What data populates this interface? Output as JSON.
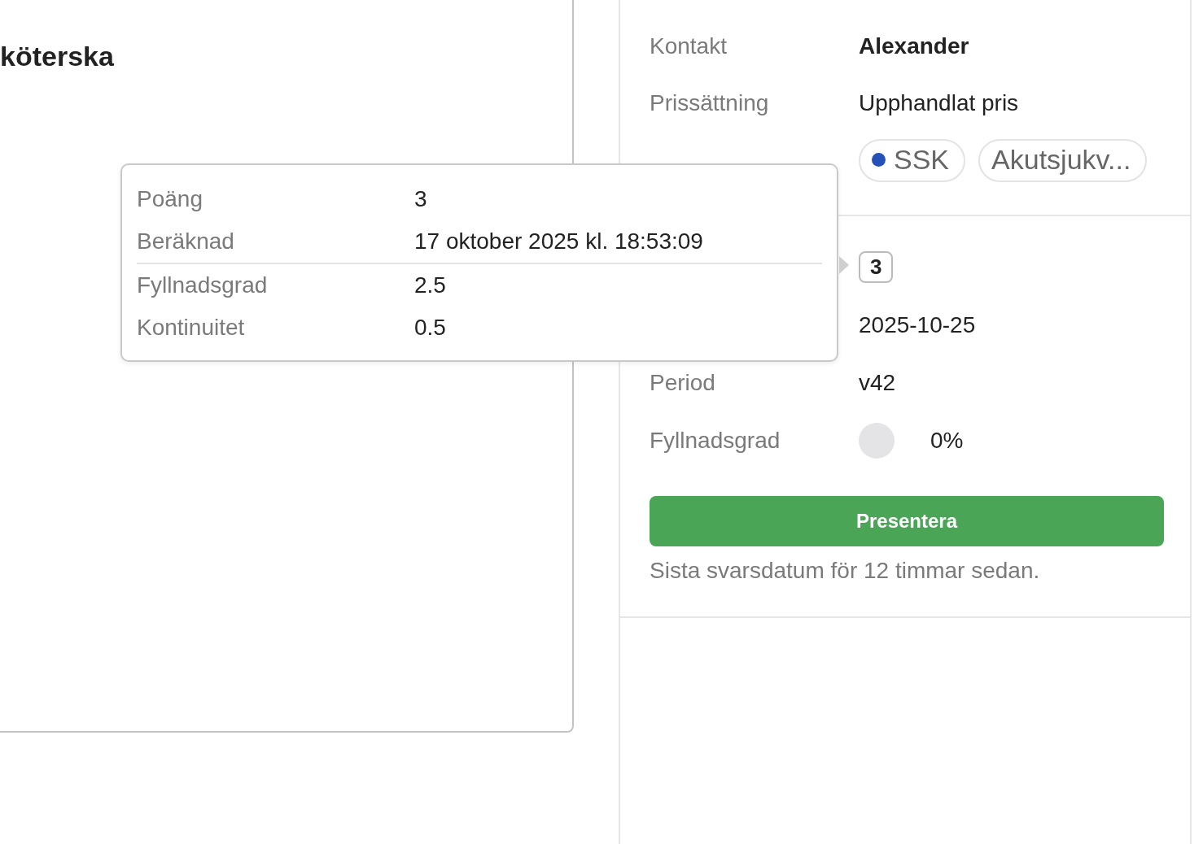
{
  "page_title": "köterska",
  "details": [
    {
      "kind": "bold",
      "label": "Kontakt",
      "value": "Alexander"
    },
    {
      "kind": "text",
      "label": "Prissättning",
      "value": "Upphandlat pris"
    },
    {
      "kind": "tags",
      "tags": [
        {
          "text": "SSK",
          "color": "#2452b8"
        },
        {
          "text": "Akutsjukv..."
        }
      ]
    }
  ],
  "stats": [
    {
      "kind": "score",
      "value": "3"
    },
    {
      "kind": "text",
      "value": "2025-10-25"
    },
    {
      "kind": "text",
      "label": "Period",
      "value": "v42"
    },
    {
      "kind": "fill",
      "label": "Fyllnadsgrad",
      "level": 0,
      "value": "0%"
    }
  ],
  "button": "Presentera",
  "note": "Sista svarsdatum för 12 timmar sedan.",
  "tooltip": {
    "sections": [
      [
        {
          "label": "Poäng",
          "value": "3"
        },
        {
          "label": "Beräknad",
          "value": "17 oktober 2025 kl. 18:53:09"
        }
      ],
      [
        {
          "label": "Fyllnadsgrad",
          "value": "2.5"
        },
        {
          "label": "Kontinuitet",
          "value": "0.5"
        }
      ]
    ]
  }
}
